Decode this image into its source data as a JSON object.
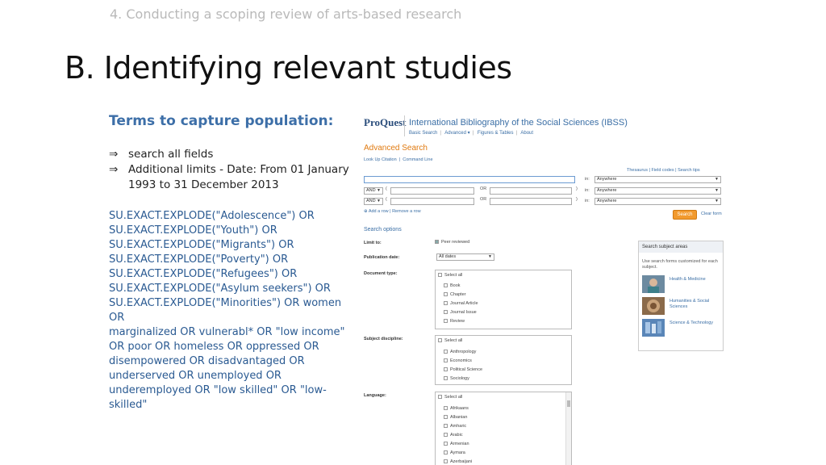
{
  "slide": {
    "caption": "4. Conducting a scoping review of arts-based research",
    "title": "B. Identifying relevant studies",
    "terms_heading": "Terms to capture population:",
    "bullets": [
      "search all fields",
      "Additional limits - Date: From 01 January 1993 to 31 December 2013"
    ],
    "query_lines": [
      "SU.EXACT.EXPLODE(\"Adolescence\") OR",
      "SU.EXACT.EXPLODE(\"Youth\") OR",
      "SU.EXACT.EXPLODE(\"Migrants\") OR",
      "SU.EXACT.EXPLODE(\"Poverty\") OR",
      "SU.EXACT.EXPLODE(\"Refugees\") OR",
      "SU.EXACT.EXPLODE(\"Asylum seekers\") OR",
      "SU.EXACT.EXPLODE(\"Minorities\") OR women OR",
      "marginalized OR vulnerabl* OR \"low income\"",
      "OR poor OR homeless OR oppressed OR",
      "disempowered OR disadvantaged OR",
      "underserved OR unemployed OR",
      "underemployed OR \"low skilled\" OR \"low-",
      "skilled\""
    ]
  },
  "proquest": {
    "logo": "ProQuest",
    "db_title": "International Bibliography of the Social Sciences (IBSS)",
    "subnav": [
      "Basic Search",
      "Advanced ▾",
      "Figures & Tables",
      "About"
    ],
    "adv_title": "Advanced Search",
    "adv_links": [
      "Look Up Citation",
      "Command Line"
    ],
    "right_links": "Thesaurus | Field codes | Search tips",
    "rows": [
      {
        "op": "",
        "paren_open": "",
        "or": "OR",
        "paren_close": "",
        "in": "in:",
        "field": "Anywhere"
      },
      {
        "op": "AND",
        "paren_open": "(",
        "or": "OR",
        "paren_close": ")",
        "in": "in:",
        "field": "Anywhere"
      },
      {
        "op": "AND",
        "paren_open": "(",
        "or": "OR",
        "paren_close": ")",
        "in": "in:",
        "field": "Anywhere"
      }
    ],
    "add_row": "⊕ Add a row  |  Remove a row",
    "search_button": "Search",
    "clear_link": "Clear form",
    "search_options": "Search options",
    "limit_label": "Limit to:",
    "peer_reviewed": "Peer reviewed",
    "pub_date_label": "Publication date:",
    "pub_date_value": "All dates",
    "doc_type_label": "Document type:",
    "doc_types": [
      "Select all",
      "Book",
      "Chapter",
      "Journal Article",
      "Journal Issue",
      "Review"
    ],
    "subject_label": "Subject discipline:",
    "subjects": [
      "Select all",
      "Anthropology",
      "Economics",
      "Political Science",
      "Sociology"
    ],
    "language_label": "Language:",
    "languages": [
      "Select all",
      "Afrikaans",
      "Albanian",
      "Amharic",
      "Arabic",
      "Armenian",
      "Aymara",
      "Azerbaijani"
    ],
    "subject_panel": {
      "head": "Search subject areas",
      "note": "Use search forms customized for each subject.",
      "items": [
        "Health & Medicine",
        "Humanities & Social Sciences",
        "Science & Technology"
      ]
    },
    "colors": {
      "accent": "#3a6ea5",
      "orange": "#e07a10",
      "search_btn": "#f29a2e",
      "heading_blue": "#3d6fa8"
    }
  }
}
